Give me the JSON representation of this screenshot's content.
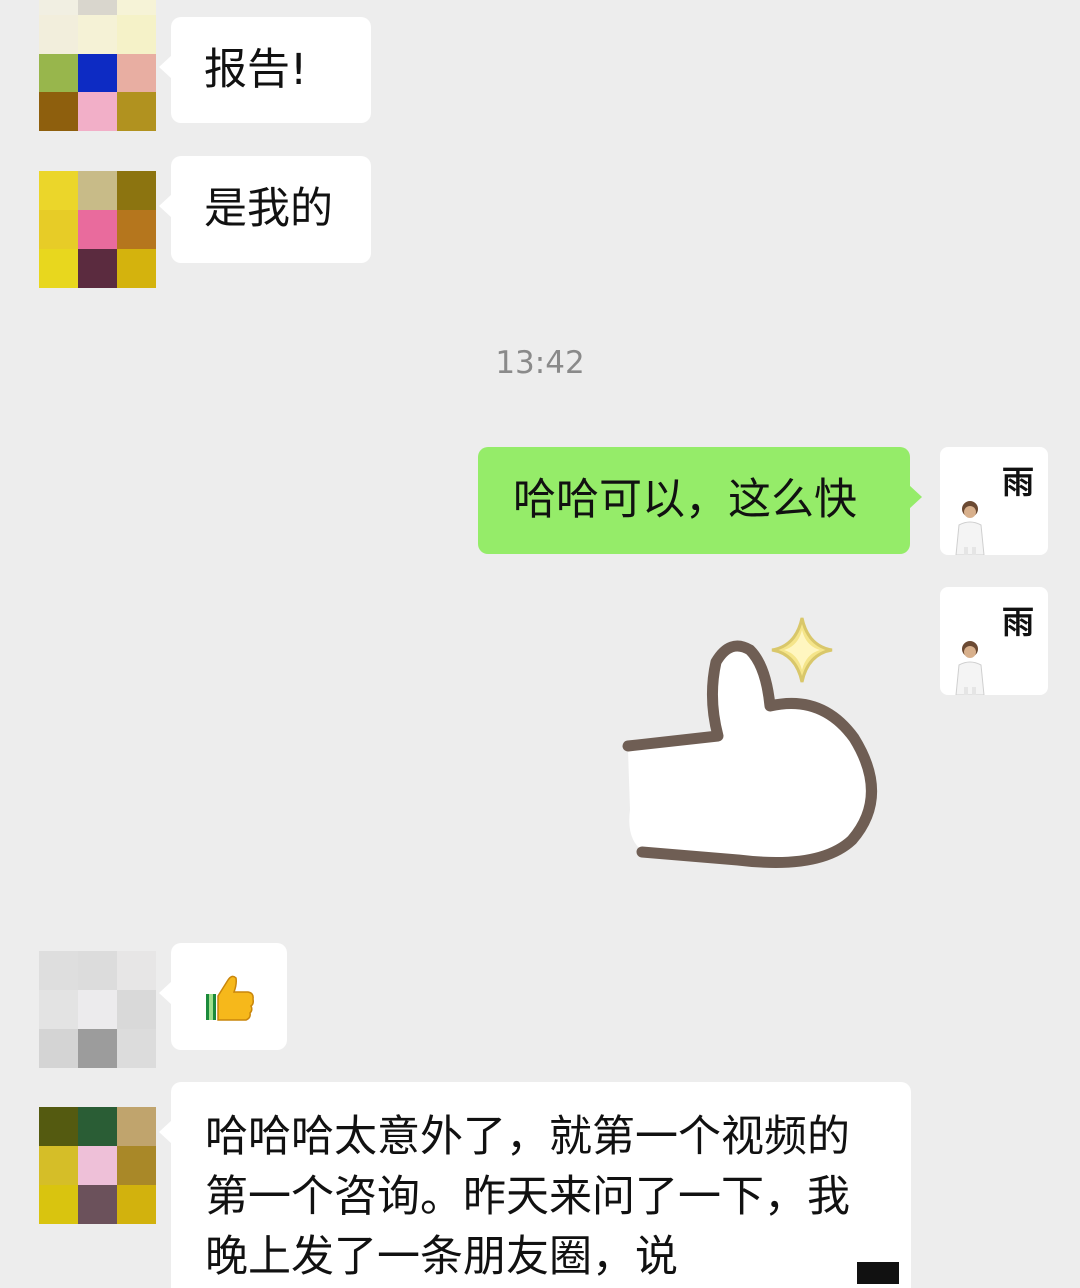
{
  "messages": {
    "msg1": {
      "text": "报告!"
    },
    "msg2": {
      "text": "是我的"
    },
    "timestamp": "13:42",
    "msg3": {
      "text": "哈哈可以，这么快"
    },
    "self_avatar_glyph": "雨",
    "msg5": {
      "icon": "thumbs-up-emoji"
    },
    "msg6": {
      "lines": [
        "哈哈哈太意外了，就第一个视频的",
        "第一个咨询。昨天来问了一下，我",
        "晚上发了一条朋友圈，说"
      ]
    }
  },
  "colors": {
    "chat_background": "#ededed",
    "incoming_bubble": "#ffffff",
    "outgoing_bubble": "#95ec69",
    "timestamp_text": "#8a8a8a"
  },
  "avatars": {
    "a1": [
      "#f1efe2",
      "#d9d6cd",
      "#f6f3d7",
      "#f2eedc",
      "#f5f2d6",
      "#f5f2c8",
      "#98b64c",
      "#0d2bc3",
      "#e8aea2",
      "#8e5f0d",
      "#f2afc8",
      "#b1921f"
    ],
    "a2": [
      "#ebd62a",
      "#c8bb88",
      "#8c7410",
      "#e7cc27",
      "#e96b9d",
      "#b5761d",
      "#e8d71e",
      "#5b2b3f",
      "#d4b30d"
    ],
    "a3": [
      "#dedede",
      "#dcdcdc",
      "#e7e6e6",
      "#e3e3e3",
      "#ecebed",
      "#d9d9d9",
      "#d4d4d4",
      "#9c9c9c",
      "#dcdcdc"
    ],
    "a4": [
      "#545a10",
      "#2a5d35",
      "#c0a46d",
      "#d5be28",
      "#eec0d8",
      "#a98828",
      "#d9c40f",
      "#6b515b",
      "#d2b20d"
    ]
  }
}
